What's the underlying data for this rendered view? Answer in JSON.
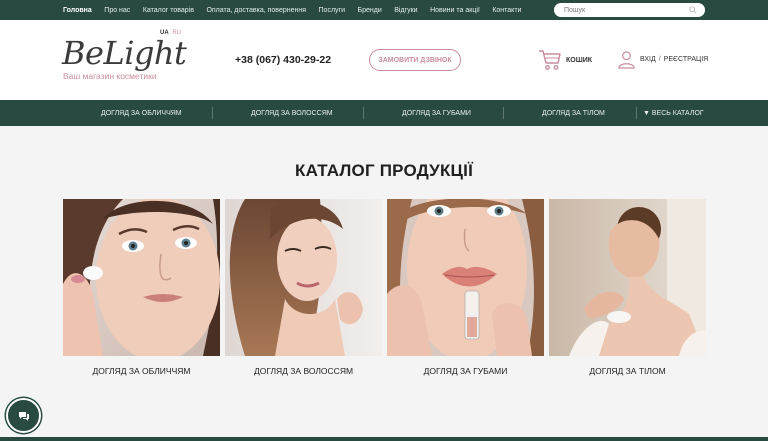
{
  "topnav": {
    "items": [
      {
        "label": "Головна",
        "active": true
      },
      {
        "label": "Про нас"
      },
      {
        "label": "Каталог товарів"
      },
      {
        "label": "Оплата, доставка, повернення"
      },
      {
        "label": "Послуги"
      },
      {
        "label": "Бренди"
      },
      {
        "label": "Відгуки"
      },
      {
        "label": "Новини та акції"
      },
      {
        "label": "Контакти"
      }
    ],
    "search_placeholder": "Пошук"
  },
  "header": {
    "logo": "BeLight",
    "tagline": "Ваш магазин косметики",
    "lang_ua": "UA",
    "lang_ru": "RU",
    "phone": "+38 (067) 430-29-22",
    "callback_label": "ЗАМОВИТИ ДЗВІНОК",
    "cart_label": "КОШИК",
    "login_label": "ВХІД",
    "login_sep": "/",
    "register_label": "РЕЄСТРАЦІЯ"
  },
  "catnav": {
    "items": [
      "ДОГЛЯД ЗА ОБЛИЧЧЯМ",
      "ДОГЛЯД ЗА ВОЛОССЯМ",
      "ДОГЛЯД ЗА ГУБАМИ",
      "ДОГЛЯД ЗА ТІЛОМ"
    ],
    "all_catalog": "▼ ВЕСЬ КАТАЛОГ"
  },
  "main": {
    "title": "КАТАЛОГ ПРОДУКЦІЇ",
    "cards": [
      {
        "label": "ДОГЛЯД ЗА ОБЛИЧЧЯМ"
      },
      {
        "label": "ДОГЛЯД ЗА ВОЛОССЯМ"
      },
      {
        "label": "ДОГЛЯД ЗА ГУБАМИ"
      },
      {
        "label": "ДОГЛЯД ЗА ТІЛОМ"
      }
    ]
  },
  "colors": {
    "brand_green": "#284a41",
    "accent_pink": "#c98e9c"
  }
}
